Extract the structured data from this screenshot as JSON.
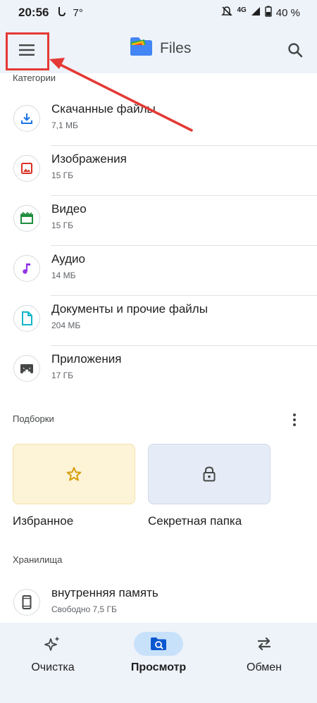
{
  "status_bar": {
    "time": "20:56",
    "temp": "7°",
    "network": "4G",
    "battery": "40 %"
  },
  "app_bar": {
    "title": "Files",
    "menu_icon": "menu-icon",
    "search_icon": "search-icon"
  },
  "categories": {
    "label": "Категории",
    "items": [
      {
        "name": "Скачанные файлы",
        "size": "7,1 МБ",
        "icon": "download-icon",
        "color": "#1a73e8"
      },
      {
        "name": "Изображения",
        "size": "15 ГБ",
        "icon": "image-icon",
        "color": "#d93025"
      },
      {
        "name": "Видео",
        "size": "15 ГБ",
        "icon": "video-icon",
        "color": "#1e8e3e"
      },
      {
        "name": "Аудио",
        "size": "14 МБ",
        "icon": "audio-icon",
        "color": "#9334e6"
      },
      {
        "name": "Документы и прочие файлы",
        "size": "204 МБ",
        "icon": "document-icon",
        "color": "#12b5cb"
      },
      {
        "name": "Приложения",
        "size": "17 ГБ",
        "icon": "android-icon",
        "color": "#444746"
      }
    ]
  },
  "collections": {
    "label": "Подборки",
    "favorites": "Избранное",
    "safe_folder": "Секретная папка"
  },
  "storage": {
    "label": "Хранилища",
    "internal_name": "внутренняя память",
    "internal_free": "Свободно 7,5 ГБ"
  },
  "bottom_nav": {
    "clean": "Очистка",
    "browse": "Просмотр",
    "share": "Обмен"
  },
  "colors": {
    "accent": "#c8e1fa",
    "bar_bg": "#eef2f9",
    "annotation": "#e53935"
  }
}
